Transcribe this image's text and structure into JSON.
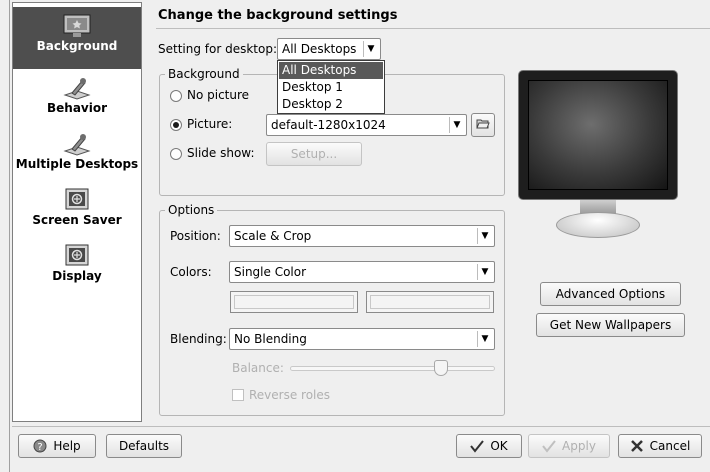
{
  "sidebar": {
    "items": [
      {
        "label": "Background",
        "icon": "background-icon",
        "selected": true
      },
      {
        "label": "Behavior",
        "icon": "behavior-icon"
      },
      {
        "label": "Multiple Desktops",
        "icon": "multiple-desktops-icon"
      },
      {
        "label": "Screen Saver",
        "icon": "screen-saver-icon"
      },
      {
        "label": "Display",
        "icon": "display-icon"
      }
    ]
  },
  "header": {
    "title": "Change the background settings"
  },
  "desktop_setting": {
    "label": "Setting for desktop:",
    "value": "All Desktops",
    "options": [
      "All Desktops",
      "Desktop 1",
      "Desktop 2"
    ]
  },
  "background": {
    "group_title": "Background",
    "no_picture_label": "No picture",
    "picture_label": "Picture:",
    "picture_value": "default-1280x1024",
    "slideshow_label": "Slide show:",
    "setup_label": "Setup..."
  },
  "options": {
    "group_title": "Options",
    "position_label": "Position:",
    "position_value": "Scale & Crop",
    "colors_label": "Colors:",
    "colors_value": "Single Color",
    "blending_label": "Blending:",
    "blending_value": "No Blending",
    "balance_label": "Balance:",
    "reverse_label": "Reverse roles",
    "balance_level": 0.72
  },
  "buttons": {
    "advanced": "Advanced Options",
    "get_new": "Get New Wallpapers",
    "help": "Help",
    "defaults": "Defaults",
    "ok": "OK",
    "apply": "Apply",
    "cancel": "Cancel"
  },
  "colors": {
    "selection": "#4e4e4e",
    "window_bg": "#efefef"
  }
}
